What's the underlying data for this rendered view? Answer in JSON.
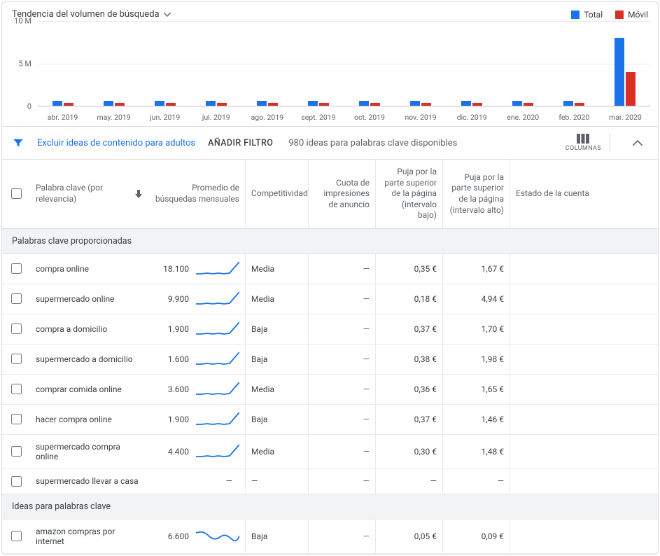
{
  "chart": {
    "title": "Tendencia del volumen de búsqueda",
    "legend": {
      "total": "Total",
      "movil": "Móvil"
    },
    "y_ticks": [
      "10 M",
      "5 M",
      "0"
    ]
  },
  "chart_data": {
    "type": "bar",
    "title": "Tendencia del volumen de búsqueda",
    "xlabel": "",
    "ylabel": "",
    "ylim": [
      0,
      10000000
    ],
    "categories": [
      "abr. 2019",
      "may. 2019",
      "jun. 2019",
      "jul. 2019",
      "ago. 2019",
      "sept. 2019",
      "oct. 2019",
      "nov. 2019",
      "dic. 2019",
      "ene. 2020",
      "feb. 2020",
      "mar. 2020"
    ],
    "series": [
      {
        "name": "Total",
        "color": "#1a73e8",
        "values": [
          550000,
          550000,
          550000,
          550000,
          550000,
          550000,
          550000,
          600000,
          550000,
          550000,
          550000,
          8000000
        ]
      },
      {
        "name": "Móvil",
        "color": "#d93025",
        "values": [
          300000,
          300000,
          300000,
          300000,
          300000,
          300000,
          300000,
          330000,
          300000,
          300000,
          300000,
          4000000
        ]
      }
    ]
  },
  "filters": {
    "exclude_adult": "Excluir ideas de contenido para adultos",
    "add_filter": "AÑADIR FILTRO",
    "ideas_available": "980 ideas para palabras clave disponibles",
    "columns_label": "COLUMNAS"
  },
  "columns": {
    "keyword": "Palabra clave (por relevancia)",
    "avg": "Promedio de búsquedas mensuales",
    "comp": "Competitividad",
    "impr": "Cuota de impresiones de anuncio",
    "bid_low": "Puja por la parte superior de la página (intervalo bajo)",
    "bid_high": "Puja por la parte superior de la página (intervalo alto)",
    "status": "Estado de la cuenta"
  },
  "sections": {
    "provided": "Palabras clave proporcionadas",
    "ideas": "Ideas para palabras clave"
  },
  "rows_provided": [
    {
      "kw": "compra online",
      "avg": "18.100",
      "comp": "Media",
      "impr": "—",
      "low": "0,35 €",
      "high": "1,67 €",
      "spark": "rise"
    },
    {
      "kw": "supermercado online",
      "avg": "9.900",
      "comp": "Media",
      "impr": "—",
      "low": "0,18 €",
      "high": "4,94 €",
      "spark": "rise"
    },
    {
      "kw": "compra a domicilio",
      "avg": "1.900",
      "comp": "Baja",
      "impr": "—",
      "low": "0,37 €",
      "high": "1,70 €",
      "spark": "rise"
    },
    {
      "kw": "supermercado a domicilio",
      "avg": "1.600",
      "comp": "Baja",
      "impr": "—",
      "low": "0,38 €",
      "high": "1,98 €",
      "spark": "rise"
    },
    {
      "kw": "comprar comida online",
      "avg": "3.600",
      "comp": "Media",
      "impr": "—",
      "low": "0,36 €",
      "high": "1,65 €",
      "spark": "rise"
    },
    {
      "kw": "hacer compra online",
      "avg": "1.900",
      "comp": "Baja",
      "impr": "—",
      "low": "0,37 €",
      "high": "1,46 €",
      "spark": "rise"
    },
    {
      "kw": "supermercado compra online",
      "avg": "4.400",
      "comp": "Media",
      "impr": "—",
      "low": "0,30 €",
      "high": "1,48 €",
      "spark": "rise"
    },
    {
      "kw": "supermercado llevar a casa",
      "avg": "—",
      "comp": "—",
      "impr": "—",
      "low": "—",
      "high": "—",
      "spark": "none"
    }
  ],
  "rows_ideas": [
    {
      "kw": "amazon compras por internet",
      "avg": "6.600",
      "comp": "Baja",
      "impr": "—",
      "low": "0,05 €",
      "high": "0,09 €",
      "spark": "wave"
    }
  ]
}
